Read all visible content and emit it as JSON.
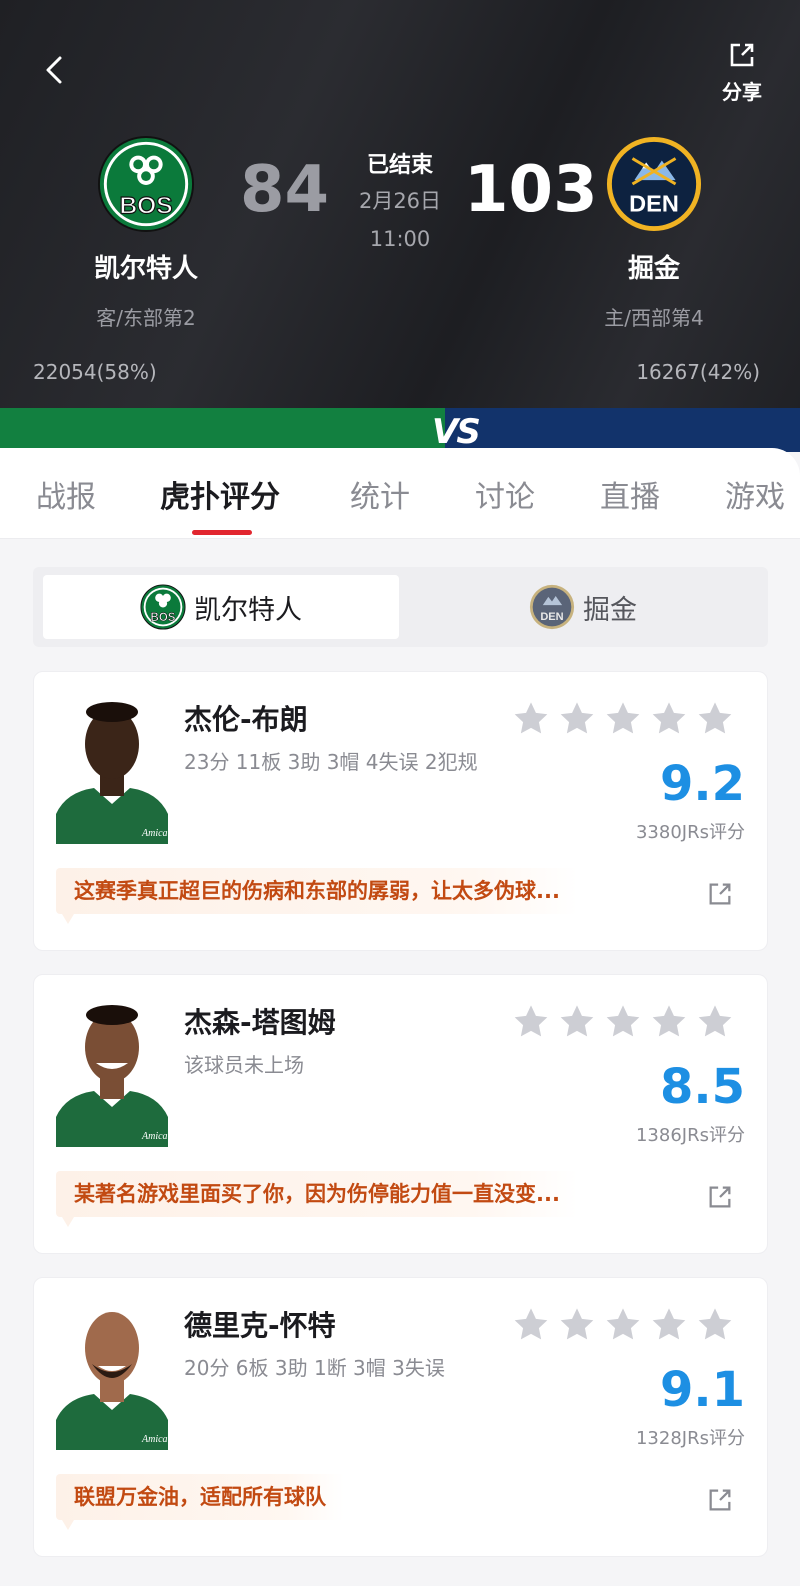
{
  "header": {
    "share_label": "分享",
    "status": "已结束",
    "date": "2月26日",
    "time": "11:00",
    "away": {
      "abbr": "BOS",
      "name": "凯尔特人",
      "rank": "客/东部第2",
      "score": "84",
      "votes": "22054(58%)",
      "color": "#128040"
    },
    "home": {
      "abbr": "DEN",
      "name": "掘金",
      "rank": "主/西部第4",
      "score": "103",
      "votes": "16267(42%)",
      "color": "#12336b"
    },
    "vs_label": "VS"
  },
  "tabs": [
    {
      "label": "战报"
    },
    {
      "label": "虎扑评分"
    },
    {
      "label": "统计"
    },
    {
      "label": "讨论"
    },
    {
      "label": "直播"
    },
    {
      "label": "游戏"
    }
  ],
  "active_tab": "虎扑评分",
  "team_toggle": {
    "left": "凯尔特人",
    "right": "掘金",
    "selected": "凯尔特人"
  },
  "players": [
    {
      "name": "杰伦-布朗",
      "stats": "23分 11板 3助 3帽 4失误 2犯规",
      "rating": "9.2",
      "count": "3380JRs评分",
      "comment": "这赛季真正超巨的伤病和东部的孱弱，让太多伪球...",
      "jersey": "Amica"
    },
    {
      "name": "杰森-塔图姆",
      "stats": "该球员未上场",
      "rating": "8.5",
      "count": "1386JRs评分",
      "comment": "某著名游戏里面买了你，因为伤停能力值一直没变...",
      "jersey": "Amica"
    },
    {
      "name": "德里克-怀特",
      "stats": "20分 6板 3助 1断 3帽 3失误",
      "rating": "9.1",
      "count": "1328JRs评分",
      "comment": "联盟万金油，适配所有球队",
      "jersey": "Amica"
    }
  ]
}
